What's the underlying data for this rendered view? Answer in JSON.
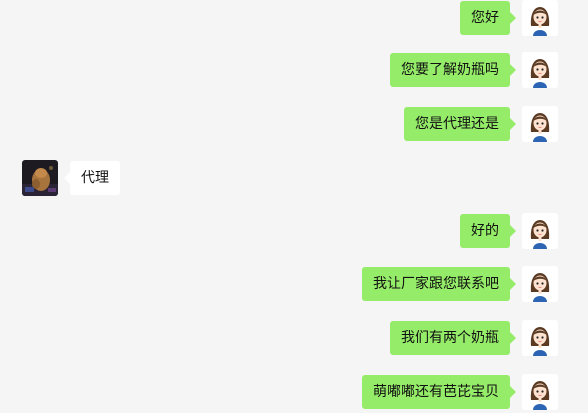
{
  "conversation": {
    "messages": [
      {
        "side": "right",
        "text": "您好"
      },
      {
        "side": "right",
        "text": "您要了解奶瓶吗"
      },
      {
        "side": "right",
        "text": "您是代理还是"
      },
      {
        "side": "left",
        "text": "代理"
      },
      {
        "side": "right",
        "text": "好的"
      },
      {
        "side": "right",
        "text": "我让厂家跟您联系吧"
      },
      {
        "side": "right",
        "text": "我们有两个奶瓶"
      },
      {
        "side": "right",
        "text": "萌嘟嘟还有芭芘宝贝"
      }
    ]
  },
  "colors": {
    "background": "#f5f5f5",
    "outgoing_bubble": "#95ec69",
    "incoming_bubble": "#ffffff"
  },
  "icons": {
    "self_avatar": "cartoon-girl-avatar-icon",
    "contact_avatar": "photo-avatar-icon"
  }
}
